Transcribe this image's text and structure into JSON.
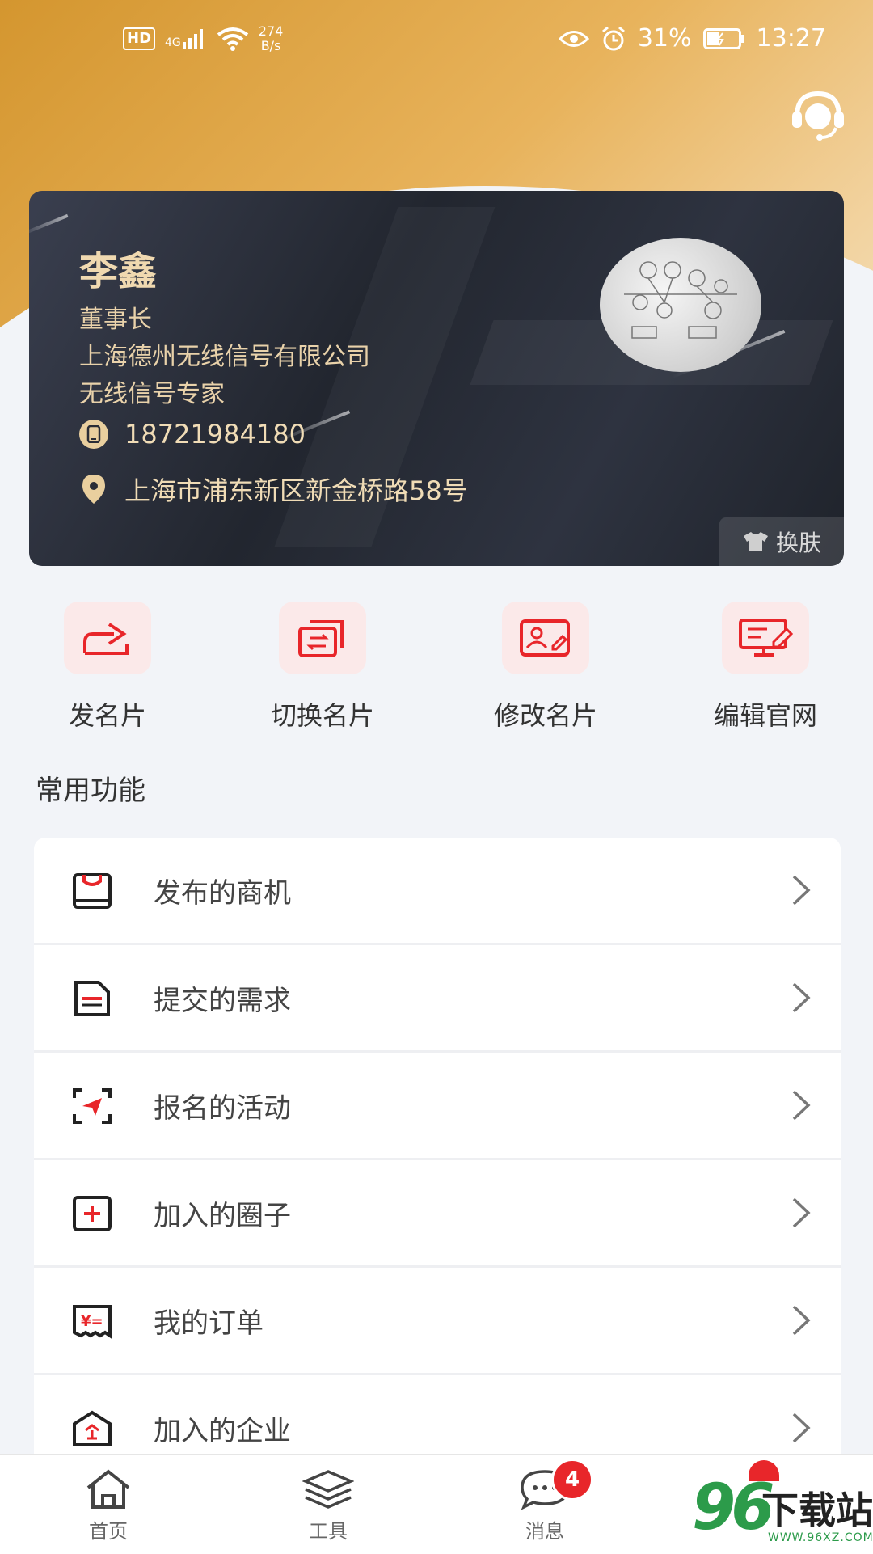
{
  "status_bar": {
    "hd": "HD",
    "signal": "4G",
    "net_speed_value": "274",
    "net_speed_unit": "B/s",
    "battery": "31%",
    "time": "13:27"
  },
  "card": {
    "name": "李鑫",
    "title": "董事长",
    "company": "上海德州无线信号有限公司",
    "slogan": "无线信号专家",
    "phone": "18721984180",
    "address": "上海市浦东新区新金桥路58号",
    "skin_label": "换肤"
  },
  "actions": [
    {
      "label": "发名片",
      "icon": "share-card-icon"
    },
    {
      "label": "切换名片",
      "icon": "switch-card-icon"
    },
    {
      "label": "修改名片",
      "icon": "edit-card-icon"
    },
    {
      "label": "编辑官网",
      "icon": "edit-website-icon"
    }
  ],
  "section_title": "常用功能",
  "list": [
    {
      "label": "发布的商机",
      "icon": "opportunity-icon"
    },
    {
      "label": "提交的需求",
      "icon": "requirement-icon"
    },
    {
      "label": "报名的活动",
      "icon": "activity-icon"
    },
    {
      "label": "加入的圈子",
      "icon": "circle-icon"
    },
    {
      "label": "我的订单",
      "icon": "order-icon"
    },
    {
      "label": "加入的企业",
      "icon": "enterprise-icon"
    }
  ],
  "tabbar": [
    {
      "label": "首页",
      "icon": "home-icon"
    },
    {
      "label": "工具",
      "icon": "layers-icon"
    },
    {
      "label": "消息",
      "icon": "message-icon",
      "badge": "4"
    }
  ],
  "watermark": {
    "number": "96",
    "text": "下载站",
    "url": "WWW.96XZ.COM"
  },
  "colors": {
    "accent": "#e8262a",
    "gold": "#e9cf9e",
    "hero": "#d4962f"
  }
}
